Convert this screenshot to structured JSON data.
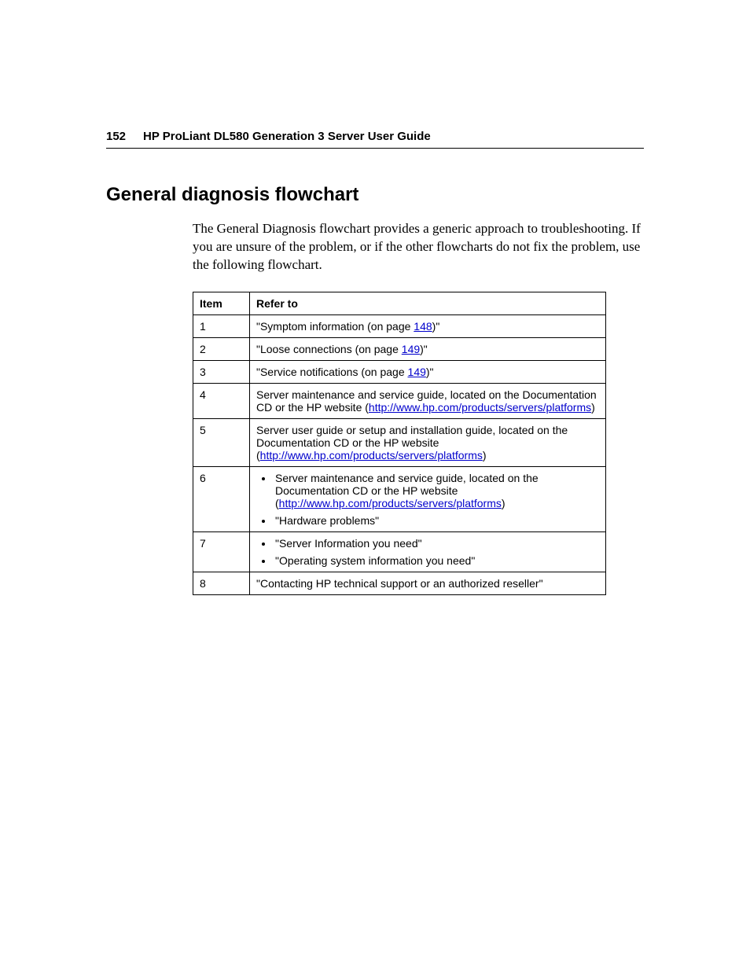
{
  "header": {
    "page_number": "152",
    "title": "HP ProLiant DL580 Generation 3 Server User Guide"
  },
  "section": {
    "heading": "General diagnosis flowchart",
    "intro": "The General Diagnosis flowchart provides a generic approach to troubleshooting. If you are unsure of the problem, or if the other flowcharts do not fix the problem, use the following flowchart."
  },
  "table": {
    "headers": {
      "item": "Item",
      "refer_to": "Refer to"
    },
    "rows": {
      "r1": {
        "item": "1",
        "prefix": "\"Symptom information (on page ",
        "link": "148",
        "suffix": ")\""
      },
      "r2": {
        "item": "2",
        "prefix": "\"Loose connections (on page ",
        "link": "149",
        "suffix": ")\""
      },
      "r3": {
        "item": "3",
        "prefix": "\"Service notifications (on page ",
        "link": "149",
        "suffix": ")\""
      },
      "r4": {
        "item": "4",
        "prefix": "Server maintenance and service guide, located on the Documentation CD or the HP website (",
        "link": "http://www.hp.com/products/servers/platforms",
        "suffix": ")"
      },
      "r5": {
        "item": "5",
        "prefix": "Server user guide or setup and installation guide, located on the Documentation CD or the HP website (",
        "link": "http://www.hp.com/products/servers/platforms",
        "suffix": ")"
      },
      "r6": {
        "item": "6",
        "b1_prefix": "Server maintenance and service guide, located on the Documentation CD or the HP website (",
        "b1_link": "http://www.hp.com/products/servers/platforms",
        "b1_suffix": ")",
        "b2": "\"Hardware problems\""
      },
      "r7": {
        "item": "7",
        "b1": "\"Server Information you need\"",
        "b2": "\"Operating system information you need\""
      },
      "r8": {
        "item": "8",
        "text": "\"Contacting HP technical support or an authorized reseller\""
      }
    }
  }
}
